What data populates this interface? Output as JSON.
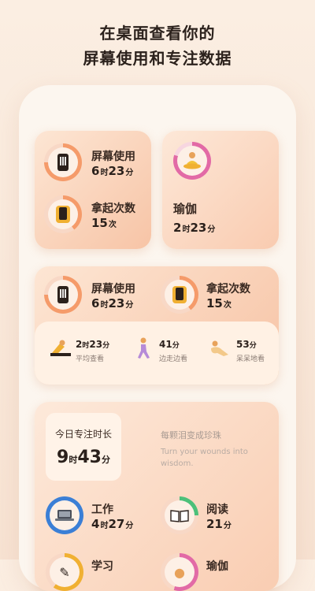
{
  "headline": {
    "line1": "在桌面查看你的",
    "line2": "屏幕使用和专注数据"
  },
  "colors": {
    "accent": "#f59b6a",
    "pink": "#e26aa6",
    "blue": "#3b7fd6",
    "green": "#4cc07a",
    "yellow": "#f0b032"
  },
  "widget_small": {
    "screen": {
      "label": "屏幕使用",
      "hours": "6",
      "h_unit": "时",
      "minutes": "23",
      "m_unit": "分",
      "icon": "phone-icon"
    },
    "pickup": {
      "label": "拿起次数",
      "count": "15",
      "unit": "次",
      "icon": "hand-phone-icon"
    }
  },
  "widget_yoga": {
    "label": "瑜伽",
    "hours": "2",
    "h_unit": "时",
    "minutes": "23",
    "m_unit": "分",
    "icon": "meditation-icon"
  },
  "widget_medium": {
    "screen": {
      "label": "屏幕使用",
      "hours": "6",
      "h_unit": "时",
      "minutes": "23",
      "m_unit": "分"
    },
    "pickup": {
      "label": "拿起次数",
      "count": "15",
      "unit": "次"
    },
    "stats": [
      {
        "value": "2",
        "unit1": "时",
        "value2": "23",
        "unit2": "分",
        "label": "平均查看",
        "icon": "lying-person-icon"
      },
      {
        "value": "41",
        "unit1": "分",
        "value2": "",
        "unit2": "",
        "label": "边走边看",
        "icon": "walking-person-icon"
      },
      {
        "value": "53",
        "unit1": "分",
        "value2": "",
        "unit2": "",
        "label": "呆呆地看",
        "icon": "sitting-person-icon"
      }
    ]
  },
  "widget_focus": {
    "title": "今日专注时长",
    "hours": "9",
    "h_unit": "时",
    "minutes": "43",
    "m_unit": "分",
    "quote_cn": "每颗泪变成珍珠",
    "quote_en": "Turn your wounds into wisdom.",
    "items": [
      {
        "label": "工作",
        "hours": "4",
        "h_unit": "时",
        "minutes": "27",
        "m_unit": "分",
        "icon": "laptop-icon"
      },
      {
        "label": "阅读",
        "hours": "",
        "h_unit": "",
        "minutes": "21",
        "m_unit": "分",
        "icon": "book-icon"
      },
      {
        "label": "学习",
        "icon": "study-icon"
      },
      {
        "label": "瑜伽",
        "icon": "yoga-icon"
      }
    ]
  }
}
